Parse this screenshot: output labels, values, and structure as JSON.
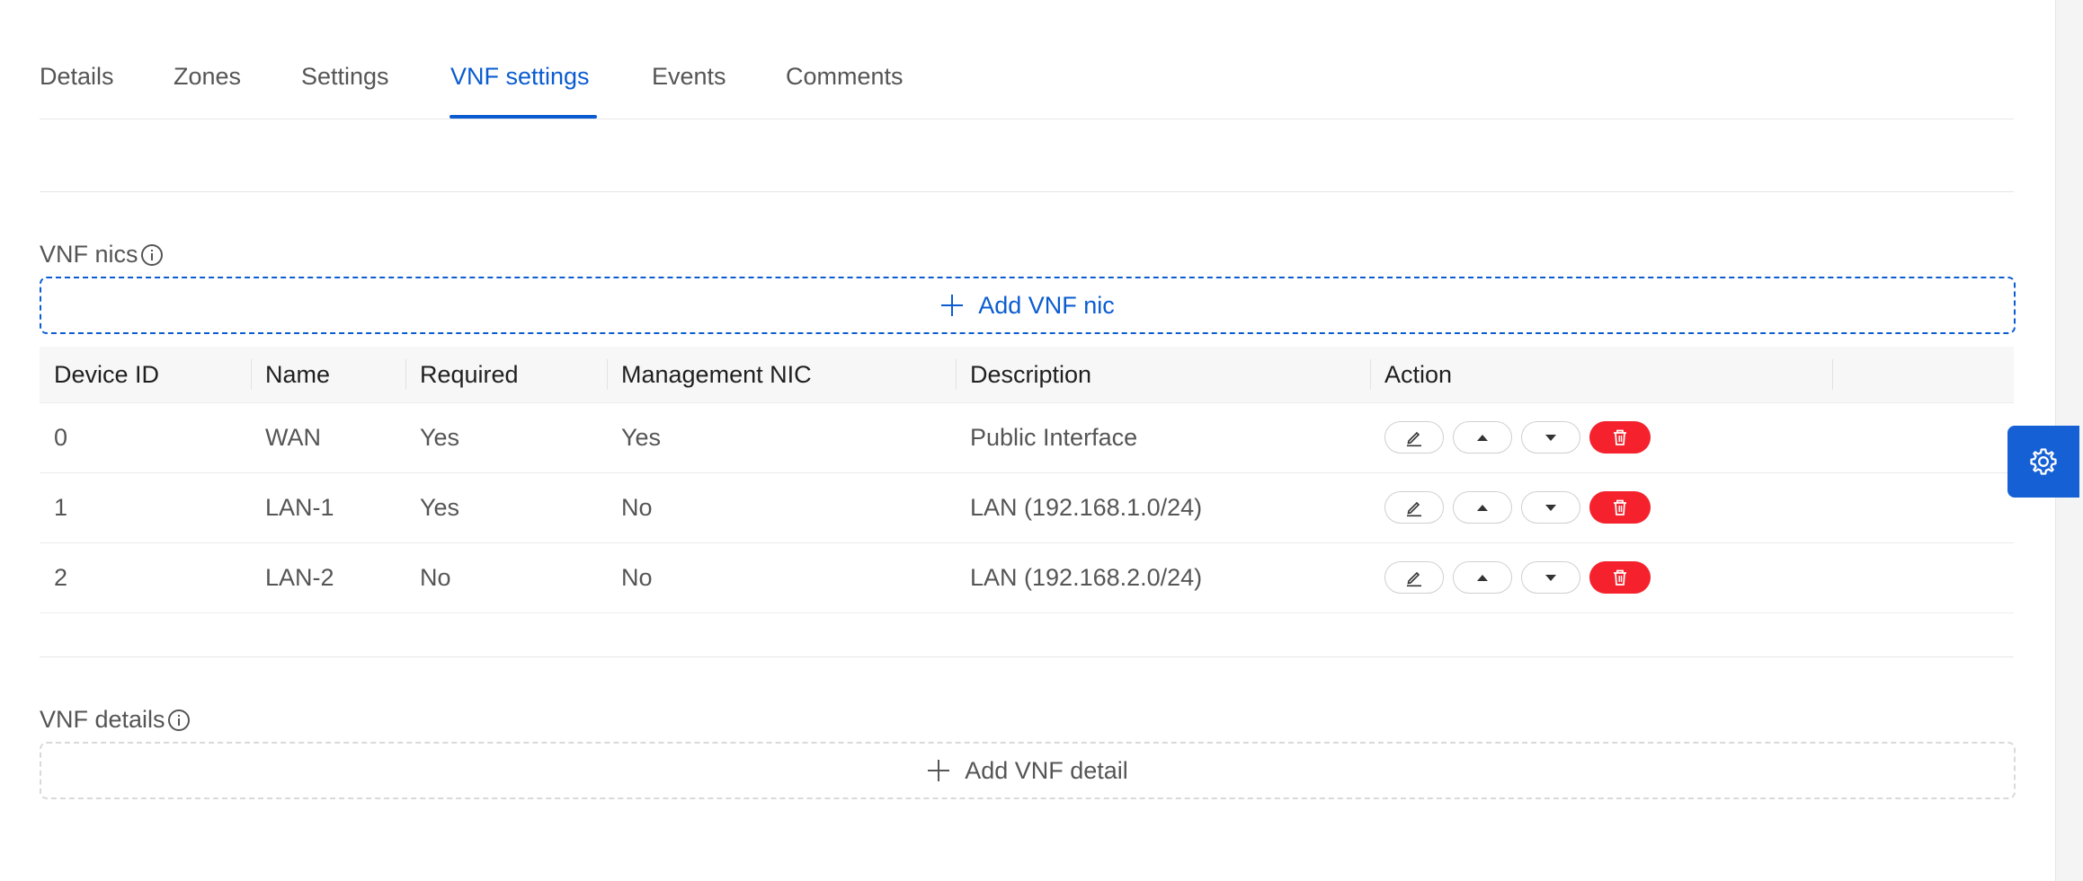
{
  "tabs": [
    {
      "label": "Details"
    },
    {
      "label": "Zones"
    },
    {
      "label": "Settings"
    },
    {
      "label": "VNF settings",
      "active": true
    },
    {
      "label": "Events"
    },
    {
      "label": "Comments"
    }
  ],
  "nics": {
    "label": "VNF nics",
    "add_label": "Add VNF nic",
    "columns": [
      "Device ID",
      "Name",
      "Required",
      "Management NIC",
      "Description",
      "Action"
    ],
    "rows": [
      {
        "device_id": "0",
        "name": "WAN",
        "required": "Yes",
        "management": "Yes",
        "description": "Public Interface"
      },
      {
        "device_id": "1",
        "name": "LAN-1",
        "required": "Yes",
        "management": "No",
        "description": "LAN (192.168.1.0/24)"
      },
      {
        "device_id": "2",
        "name": "LAN-2",
        "required": "No",
        "management": "No",
        "description": "LAN (192.168.2.0/24)"
      }
    ]
  },
  "details": {
    "label": "VNF details",
    "add_label": "Add VNF detail"
  },
  "icons": {
    "info": "info-circle-icon",
    "add": "plus-icon",
    "edit": "pencil-icon",
    "move_up": "caret-up-icon",
    "move_down": "caret-down-icon",
    "delete": "trash-icon",
    "settings": "gear-icon"
  },
  "colors": {
    "accent": "#0b5cd0",
    "danger": "#f5222d",
    "fab": "#1560d4"
  }
}
